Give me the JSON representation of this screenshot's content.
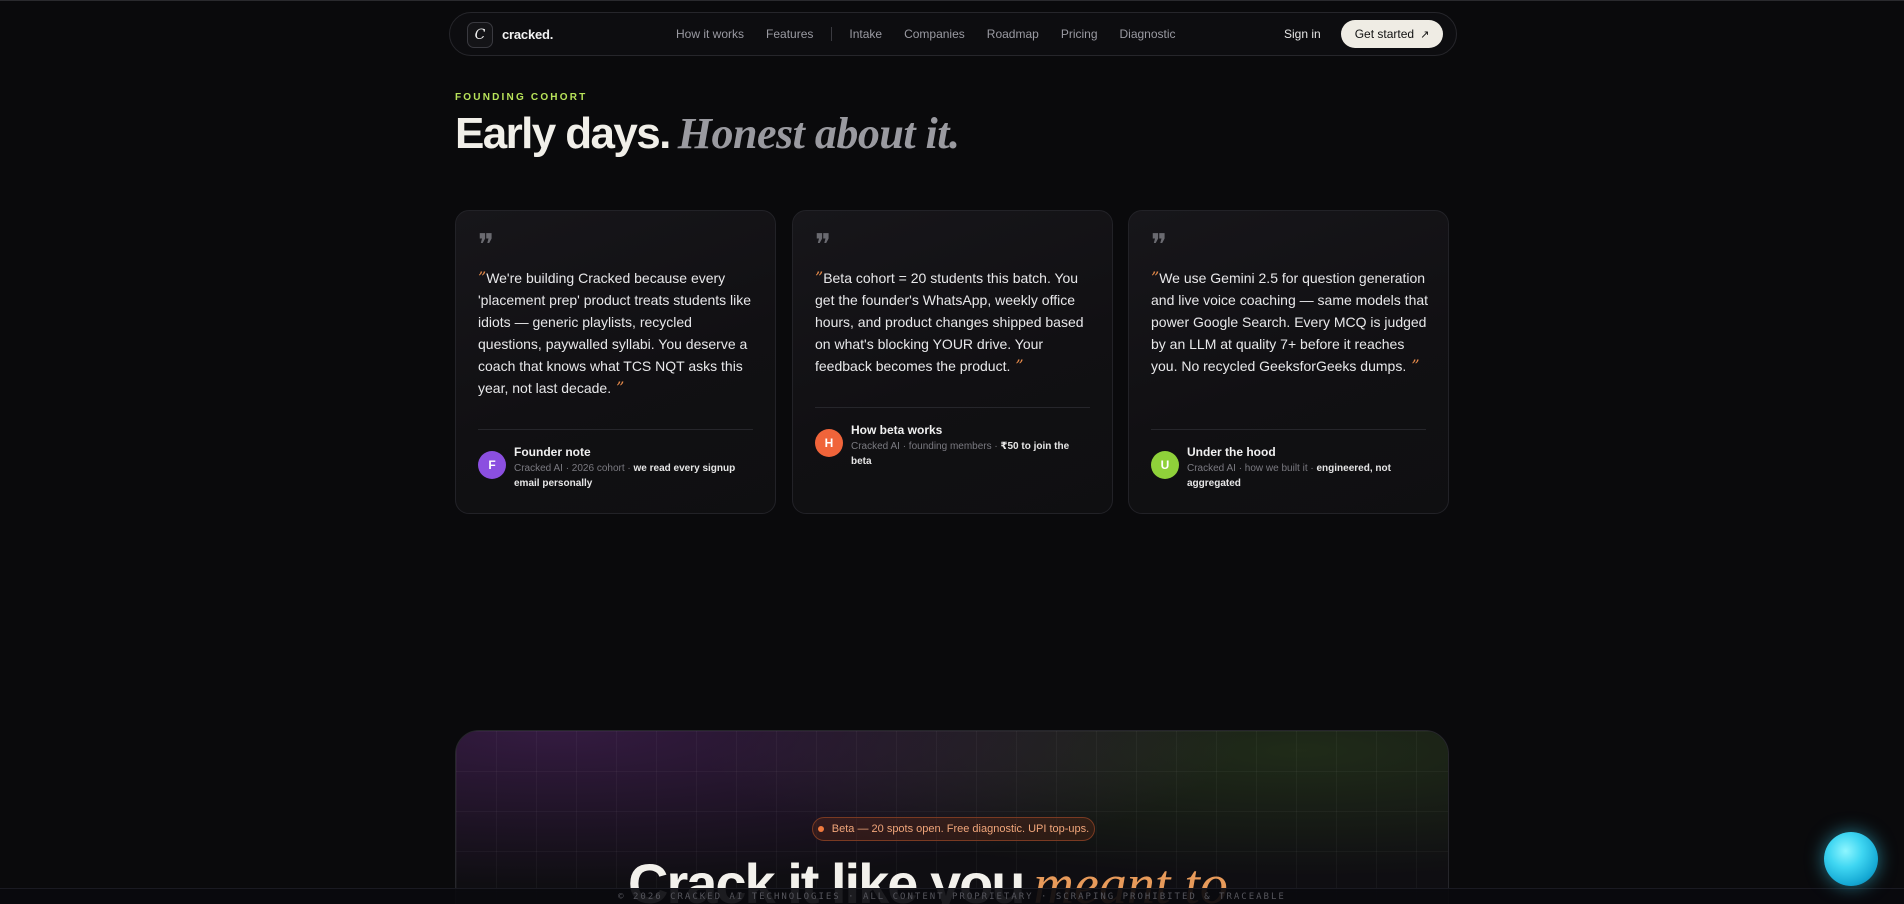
{
  "nav": {
    "logo_letter": "C",
    "brand": "cracked.",
    "links_primary": [
      "How it works",
      "Features"
    ],
    "links_secondary": [
      "Intake",
      "Companies",
      "Roadmap",
      "Pricing",
      "Diagnostic"
    ],
    "signin": "Sign in",
    "cta": "Get started",
    "cta_arrow": "↗"
  },
  "header": {
    "eyebrow": "FOUNDING COHORT",
    "title_strong": "Early days.",
    "title_italic": "Honest about it."
  },
  "cards": [
    {
      "quote": "We're building Cracked because every 'placement prep' product treats students like idiots — generic playlists, recycled questions, paywalled syllabi. You deserve a coach that knows what TCS NQT asks this year, not last decade.",
      "avatar": "F",
      "avatar_color": "#8b4fe0",
      "title": "Founder note",
      "sub_muted": "Cracked AI · 2026 cohort · ",
      "sub_strong": "we read every signup email personally"
    },
    {
      "quote": "Beta cohort = 20 students this batch. You get the founder's WhatsApp, weekly office hours, and product changes shipped based on what's blocking YOUR drive. Your feedback becomes the product.",
      "avatar": "H",
      "avatar_color": "#f0643a",
      "title": "How beta works",
      "sub_muted": "Cracked AI · founding members · ",
      "sub_strong": "₹50 to join the beta"
    },
    {
      "quote": "We use Gemini 2.5 for question generation and live voice coaching — same models that power Google Search. Every MCQ is judged by an LLM at quality 7+ before it reaches you. No recycled GeeksforGeeks dumps.",
      "avatar": "U",
      "avatar_color": "#8fd13a",
      "title": "Under the hood",
      "sub_muted": "Cracked AI · how we built it · ",
      "sub_strong": "engineered, not aggregated"
    }
  ],
  "cta_section": {
    "pill": "Beta — 20 spots open. Free diagnostic. UPI top-ups.",
    "title_strong": "Crack it like you",
    "title_italic": "meant to"
  },
  "footer": {
    "text": "© 2026 CRACKED AI TECHNOLOGIES   ·   ALL CONTENT PROPRIETARY   ·   SCRAPING PROHIBITED & TRACEABLE"
  },
  "colors": {
    "accent_green": "#b8e35a",
    "accent_orange": "#e68a4a",
    "background": "#0a0a0c"
  }
}
